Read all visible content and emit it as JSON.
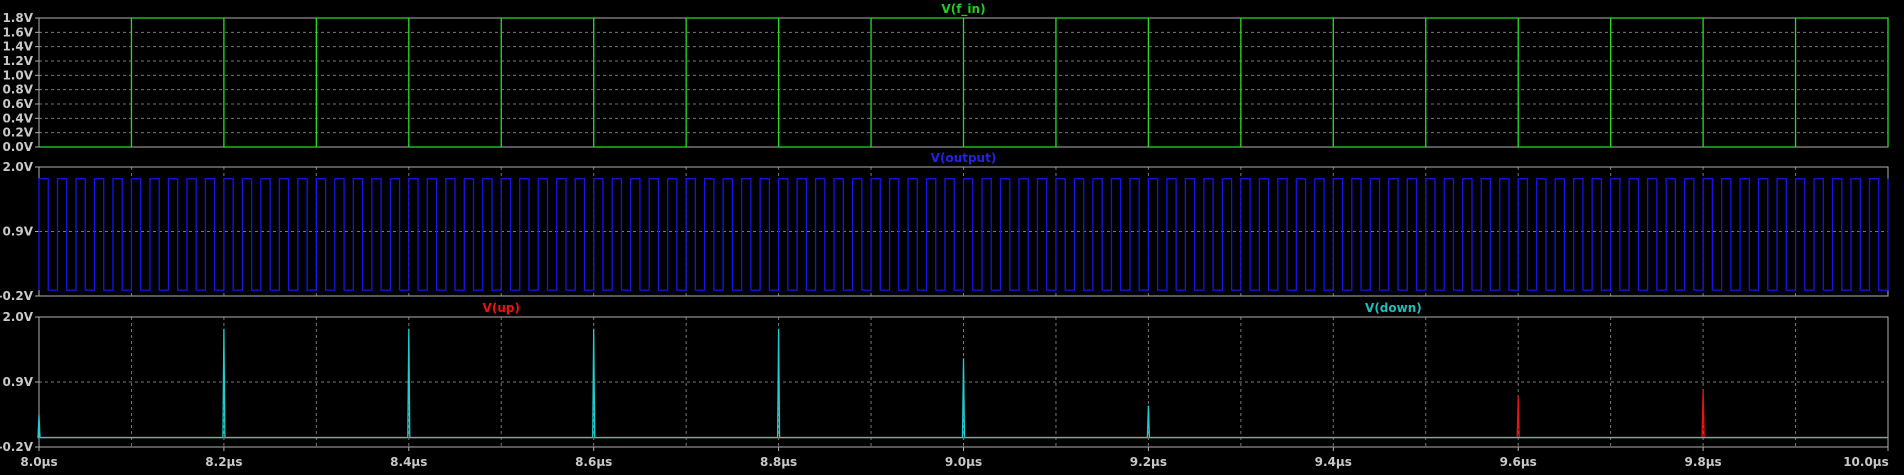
{
  "chart_data": [
    {
      "type": "line",
      "title": "V(f_in)",
      "title_color": "#22cc22",
      "ylim": [
        0.0,
        1.8
      ],
      "yticks": [
        0.0,
        0.2,
        0.4,
        0.6,
        0.8,
        1.0,
        1.2,
        1.4,
        1.6,
        1.8
      ],
      "ytick_labels": [
        "0.0V",
        "0.2V",
        "0.4V",
        "0.6V",
        "0.8V",
        "1.0V",
        "1.2V",
        "1.4V",
        "1.6V",
        "1.8V"
      ],
      "grid": true,
      "series": [
        {
          "name": "V(f_in)",
          "color": "#22dd22",
          "waveform": "square",
          "low": 0.0,
          "high": 1.8,
          "period_us": 0.2,
          "first_rise_us": 8.1,
          "duty": 0.5
        }
      ]
    },
    {
      "type": "line",
      "title": "V(output)",
      "title_color": "#2222ee",
      "ylim": [
        -0.2,
        2.0
      ],
      "yticks": [
        -0.2,
        0.9,
        2.0
      ],
      "ytick_labels": [
        "-0.2V",
        "0.9V",
        "2.0V"
      ],
      "grid": true,
      "series": [
        {
          "name": "V(output)",
          "color": "#1515ee",
          "waveform": "square",
          "low": -0.1,
          "high": 1.8,
          "period_us": 0.02,
          "first_rise_us": 8.0,
          "duty": 0.5
        }
      ]
    },
    {
      "type": "line",
      "title": [
        "V(up)",
        "V(down)"
      ],
      "title_colors": [
        "#ee1111",
        "#22bbbb"
      ],
      "ylim": [
        -0.2,
        2.0
      ],
      "yticks": [
        -0.2,
        0.9,
        2.0
      ],
      "ytick_labels": [
        "-0.2V",
        "0.9V",
        "2.0V"
      ],
      "grid": true,
      "series": [
        {
          "name": "V(up)",
          "color": "#ee1111",
          "baseline": -0.04,
          "pulses": [
            {
              "x": 9.6,
              "y": 0.65
            },
            {
              "x": 9.8,
              "y": 0.75
            }
          ]
        },
        {
          "name": "V(down)",
          "color": "#22cccc",
          "baseline": -0.04,
          "pulses": [
            {
              "x": 8.0,
              "y": 0.35
            },
            {
              "x": 8.2,
              "y": 1.8
            },
            {
              "x": 8.4,
              "y": 1.8
            },
            {
              "x": 8.6,
              "y": 1.8
            },
            {
              "x": 8.8,
              "y": 1.8
            },
            {
              "x": 9.0,
              "y": 1.3
            },
            {
              "x": 9.2,
              "y": 0.5
            }
          ]
        }
      ]
    }
  ],
  "xaxis": {
    "xlim": [
      8.0,
      10.0
    ],
    "ticks": [
      8.0,
      8.2,
      8.4,
      8.6,
      8.8,
      9.0,
      9.2,
      9.4,
      9.6,
      9.8,
      10.0
    ],
    "tick_labels": [
      "8.0µs",
      "8.2µs",
      "8.4µs",
      "8.6µs",
      "8.8µs",
      "9.0µs",
      "9.2µs",
      "9.4µs",
      "9.6µs",
      "9.8µs",
      "10.0µs"
    ],
    "minor_ticks": [
      8.1,
      8.3,
      8.5,
      8.7,
      8.9,
      9.1,
      9.3,
      9.5,
      9.7,
      9.9
    ]
  }
}
